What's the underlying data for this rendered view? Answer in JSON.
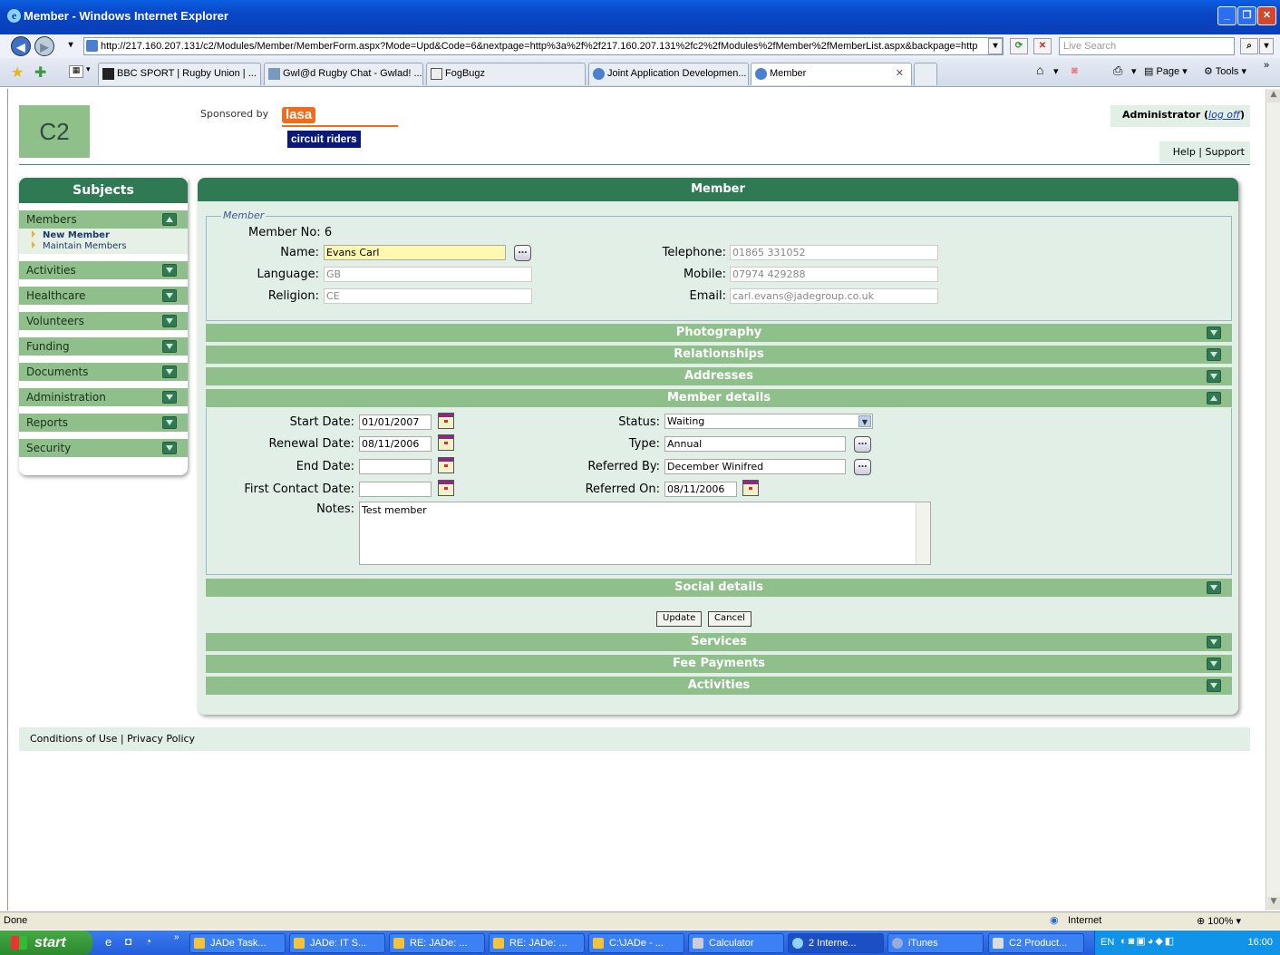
{
  "window": {
    "title": "Member - Windows Internet Explorer"
  },
  "address": {
    "url": "http://217.160.207.131/c2/Modules/Member/MemberForm.aspx?Mode=Upd&Code=6&nextpage=http%3a%2f%2f217.160.207.131%2fc2%2fModules%2fMember%2fMemberList.aspx&backpage=http",
    "search_placeholder": "Live Search"
  },
  "tabs": [
    "BBC SPORT | Rugby Union | ...",
    "Gwl@d Rugby Chat - Gwlad! ...",
    "FogBugz",
    "Joint Application Developmen...",
    "Member"
  ],
  "toolbar": {
    "page": "Page",
    "tools": "Tools"
  },
  "header": {
    "logo": "C2",
    "sponsored_by": "Sponsored by",
    "lasa": "lasa",
    "circuit_riders": "circuit riders",
    "user": "Administrator",
    "logoff": "log off",
    "help": "Help",
    "support": "Support",
    "sep": "|"
  },
  "sidebar": {
    "title": "Subjects",
    "items": [
      {
        "label": "Members",
        "expanded": true
      },
      {
        "label": "Activities"
      },
      {
        "label": "Healthcare"
      },
      {
        "label": "Volunteers"
      },
      {
        "label": "Funding"
      },
      {
        "label": "Documents"
      },
      {
        "label": "Administration"
      },
      {
        "label": "Reports"
      },
      {
        "label": "Security"
      }
    ],
    "member_links": [
      "New Member",
      "Maintain Members"
    ]
  },
  "main": {
    "title": "Member",
    "legend": "Member",
    "member_no_label": "Member No:",
    "member_no": "6",
    "fields": {
      "name_label": "Name:",
      "name": "Evans Carl",
      "language_label": "Language:",
      "language": "GB",
      "religion_label": "Religion:",
      "religion": "CE",
      "telephone_label": "Telephone:",
      "telephone": "01865 331052",
      "mobile_label": "Mobile:",
      "mobile": "07974 429288",
      "email_label": "Email:",
      "email": "carl.evans@jadegroup.co.uk"
    },
    "sections_top": [
      "Photography",
      "Relationships",
      "Addresses",
      "Member details"
    ],
    "details": {
      "start_label": "Start Date:",
      "start": "01/01/2007",
      "renewal_label": "Renewal Date:",
      "renewal": "08/11/2006",
      "end_label": "End Date:",
      "end": "",
      "first_contact_label": "First Contact Date:",
      "first_contact": "",
      "notes_label": "Notes:",
      "notes": "Test member",
      "status_label": "Status:",
      "status": "Waiting",
      "type_label": "Type:",
      "type": "Annual",
      "referred_by_label": "Referred By:",
      "referred_by": "December Winifred",
      "referred_on_label": "Referred On:",
      "referred_on": "08/11/2006"
    },
    "social": "Social details",
    "update": "Update",
    "cancel": "Cancel",
    "sections_bottom": [
      "Services",
      "Fee Payments",
      "Activities"
    ]
  },
  "footer": {
    "conditions": "Conditions of Use",
    "sep": "|",
    "privacy": "Privacy Policy"
  },
  "status": {
    "text": "Done",
    "zone": "Internet",
    "zoom": "100%"
  },
  "taskbar": {
    "start": "start",
    "tasks": [
      "JADe Task...",
      "JADe: IT S...",
      "RE: JADe: ...",
      "RE: JADe: ...",
      "C:\\JADe - ...",
      "Calculator",
      "2 Interne...",
      "iTunes",
      "C2 Product..."
    ],
    "lang": "EN",
    "clock": "16:00"
  }
}
